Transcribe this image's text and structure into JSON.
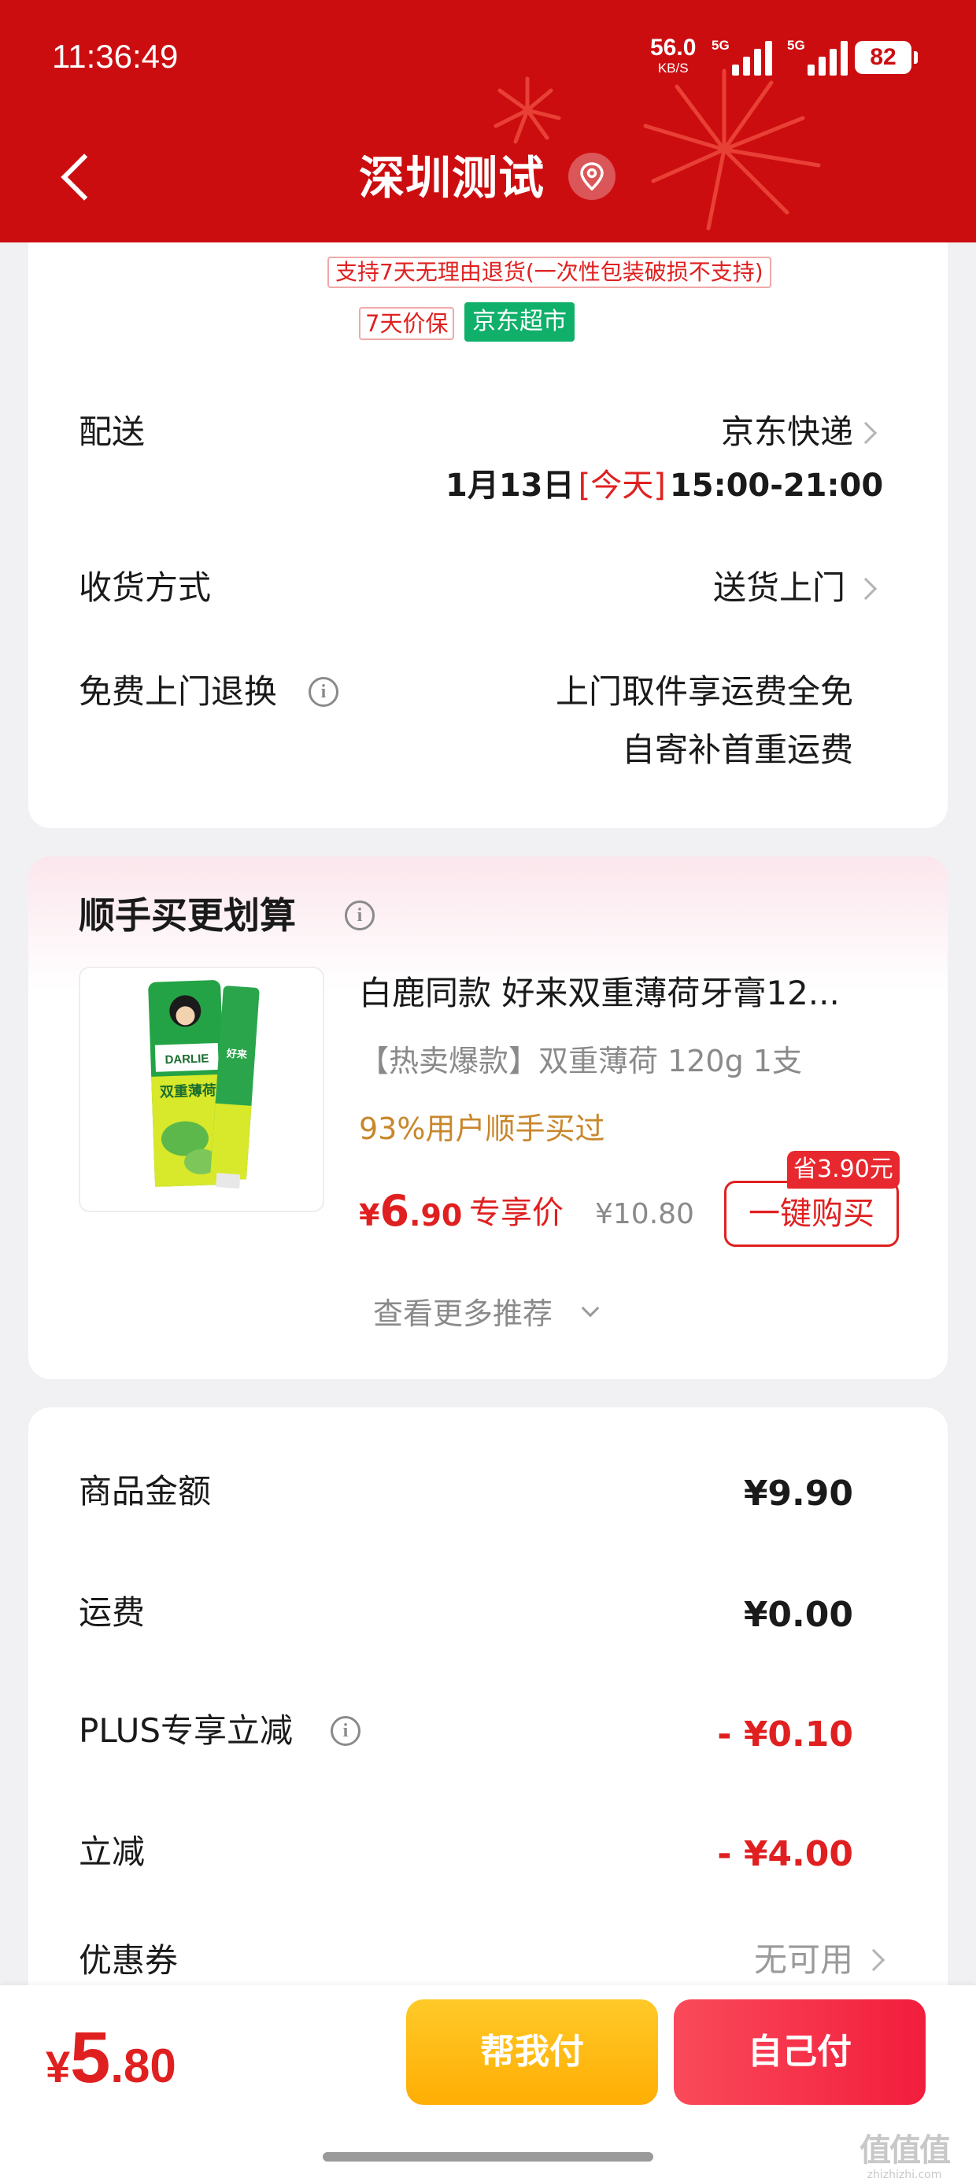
{
  "status_bar": {
    "time": "11:36:49",
    "net_speed": "56.0",
    "net_unit": "KB/S",
    "network_1": "5G",
    "network_2": "5G",
    "battery": "82"
  },
  "header": {
    "title": "深圳测试",
    "back_icon": "chevron-left-icon",
    "location_icon": "location-pin-icon",
    "background_color": "#cc0d10"
  },
  "service_tags": {
    "return_policy": "支持7天无理由退货(一次性包装破损不支持)",
    "price_protection": "7天价保",
    "store": "京东超市"
  },
  "delivery": {
    "label": "配送",
    "carrier": "京东快递",
    "date": "1月13日",
    "today": "[今天]",
    "time_range": "15:00-21:00"
  },
  "receive": {
    "label": "收货方式",
    "value": "送货上门"
  },
  "returns": {
    "label": "免费上门退换",
    "line1": "上门取件享运费全免",
    "line2": "自寄补首重运费"
  },
  "recommend": {
    "title": "顺手买更划算",
    "product": {
      "name": "白鹿同款 好来双重薄荷牙膏12...",
      "spec": "【热卖爆款】双重薄荷 120g 1支",
      "stat": "93%用户顺手买过",
      "price_symbol": "¥",
      "price_int": "6",
      "price_dec": ".90",
      "exclusive_label": "专享价",
      "original_price": "¥10.80",
      "save_badge": "省3.90元",
      "buy_label": "一键购买",
      "image_text_brand": "DARLIE",
      "image_text_cn": "好来",
      "image_text_sub": "双重薄荷"
    },
    "more_label": "查看更多推荐"
  },
  "amounts": {
    "goods": {
      "label": "商品金额",
      "value": "¥9.90"
    },
    "shipping": {
      "label": "运费",
      "value": "¥0.00"
    },
    "plus": {
      "label": "PLUS专享立减",
      "value": "- ¥0.10"
    },
    "discount": {
      "label": "立减",
      "value": "- ¥4.00"
    },
    "coupon": {
      "label": "优惠券",
      "value": "无可用"
    }
  },
  "bottom": {
    "total_symbol": "¥",
    "total_int": "5",
    "total_dec": ".80",
    "help_pay": "帮我付",
    "self_pay": "自己付"
  },
  "watermark": {
    "text": "值值值",
    "url": "zhizhizhi.com"
  },
  "colors": {
    "brand_red": "#cc0d10",
    "price_red": "#e02020",
    "store_green": "#10b06b",
    "help_pay_yellow": "#ffb80e",
    "self_pay_red": "#f2283f"
  }
}
